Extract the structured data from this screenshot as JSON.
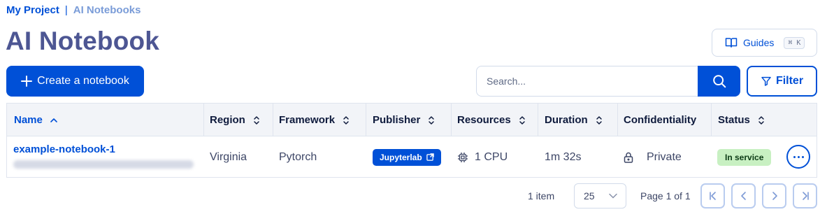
{
  "breadcrumb": {
    "current": "My Project",
    "separator": "|",
    "link": "AI Notebooks"
  },
  "page": {
    "title": "AI Notebook"
  },
  "guides": {
    "label": "Guides",
    "shortcut": "⌘ K"
  },
  "toolbar": {
    "create_label": "Create a notebook",
    "search_placeholder": "Search...",
    "filter_label": "Filter"
  },
  "table": {
    "columns": [
      "Name",
      "Region",
      "Framework",
      "Publisher",
      "Resources",
      "Duration",
      "Confidentiality",
      "Status"
    ],
    "sorted_column": "Name",
    "sort_direction": "ascending",
    "rows": [
      {
        "name": "example-notebook-1",
        "region": "Virginia",
        "framework": "Pytorch",
        "publisher": "Jupyterlab",
        "resources": "1 CPU",
        "duration": "1m 32s",
        "confidentiality": "Private",
        "status": "In service"
      }
    ]
  },
  "pagination": {
    "item_count": "1 item",
    "page_size": "25",
    "page_info": "Page 1 of 1"
  },
  "colors": {
    "primary": "#0050d7",
    "title": "#4d5693",
    "status_bg": "#c8f0c2",
    "header_bg": "#f2f4f8"
  }
}
